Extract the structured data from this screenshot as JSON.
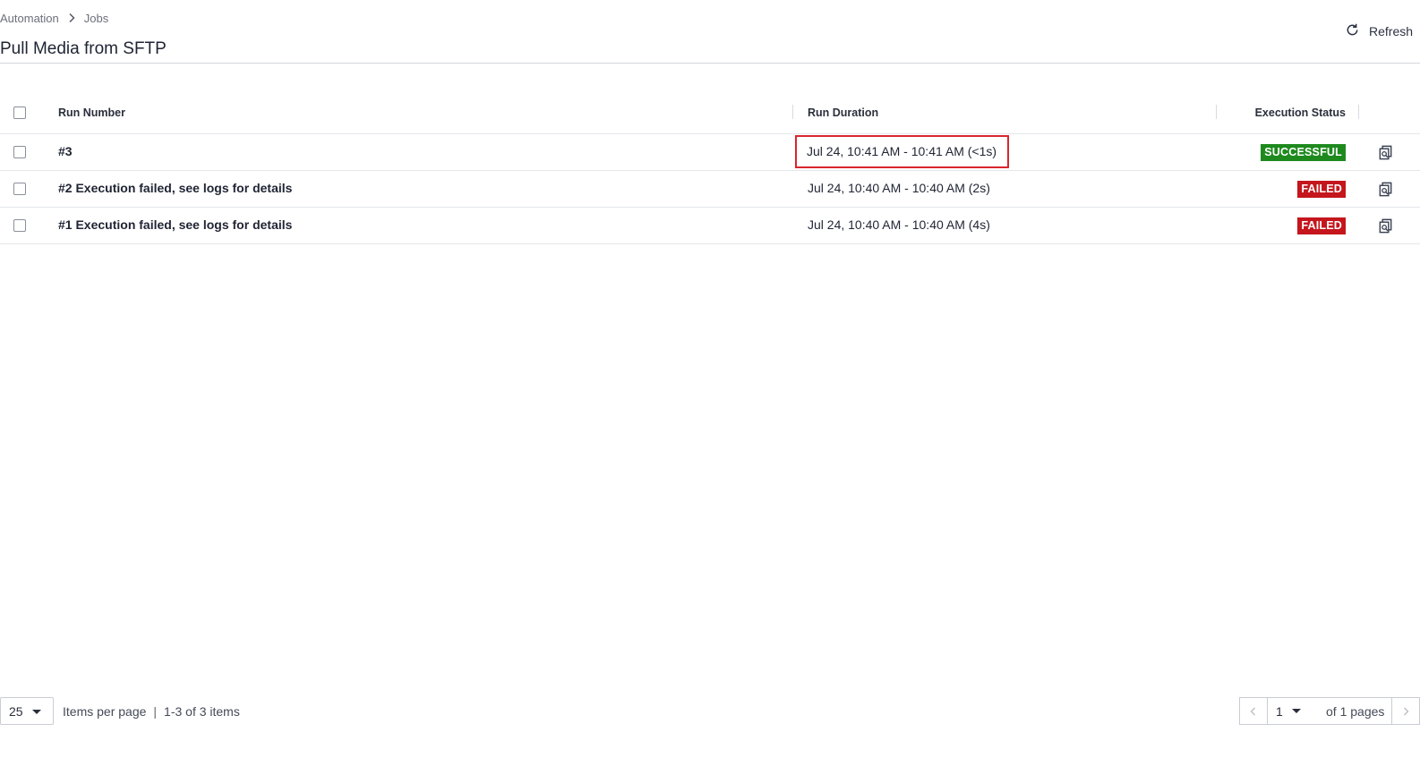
{
  "breadcrumb": {
    "root": "Automation",
    "current": "Jobs"
  },
  "page": {
    "title": "Pull Media from SFTP",
    "refresh_label": "Refresh"
  },
  "table": {
    "headers": {
      "run_number": "Run Number",
      "run_duration": "Run Duration",
      "execution_status": "Execution Status"
    },
    "rows": [
      {
        "run": "#3",
        "duration": "Jul 24, 10:41 AM - 10:41 AM (<1s)",
        "status": "SUCCESSFUL"
      },
      {
        "run": "#2 Execution failed, see logs for details",
        "duration": "Jul 24, 10:40 AM - 10:40 AM (2s)",
        "status": "FAILED"
      },
      {
        "run": "#1 Execution failed, see logs for details",
        "duration": "Jul 24, 10:40 AM - 10:40 AM (4s)",
        "status": "FAILED"
      }
    ]
  },
  "footer": {
    "per_page_value": "25",
    "items_per_page_label": "Items per page",
    "items_range": "1-3 of 3 items",
    "current_page": "1",
    "of_pages": "of 1 pages"
  },
  "icons": {
    "breadcrumb_separator": "chevron-right-icon",
    "refresh": "refresh-icon",
    "row_action": "view-logs-icon",
    "dropdown": "caret-down-icon",
    "pager_prev": "chevron-left-icon",
    "pager_next": "chevron-right-icon"
  },
  "colors": {
    "success": "#1e8a1e",
    "failed": "#c4161c",
    "highlight": "#d9262e"
  }
}
